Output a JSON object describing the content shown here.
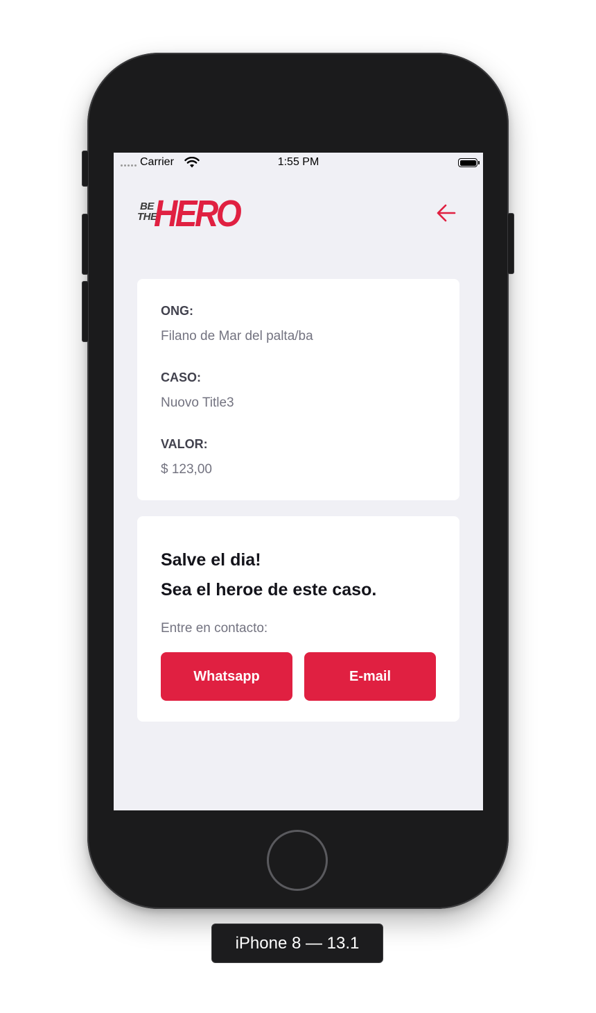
{
  "statusbar": {
    "carrier": "Carrier",
    "time": "1:55 PM"
  },
  "header": {
    "logo": {
      "line1": "BE",
      "line2": "THE",
      "word": "HERO"
    },
    "back_icon": "arrow-left-icon"
  },
  "incident": {
    "ong_label": "ONG:",
    "ong_value": "Filano de Mar del palta/ba",
    "caso_label": "CASO:",
    "caso_value": "Nuovo Title3",
    "valor_label": "VALOR:",
    "valor_value": "$ 123,00"
  },
  "contact": {
    "title_line1": "Salve el dia!",
    "title_line2": "Sea el heroe de este caso.",
    "lead": "Entre en contacto:",
    "whatsapp_label": "Whatsapp",
    "email_label": "E-mail"
  },
  "device_label": "iPhone 8 — 13.1",
  "colors": {
    "brand": "#e02041",
    "background": "#f0f0f5",
    "label": "#41414d",
    "value": "#737380",
    "title": "#13131a"
  }
}
